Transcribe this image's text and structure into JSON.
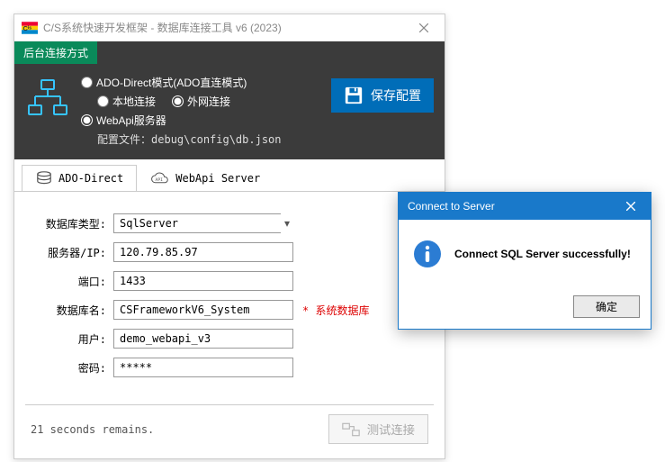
{
  "window": {
    "title": "C/S系统快速开发框架 - 数据库连接工具 v6 (2023)"
  },
  "panel": {
    "header": "后台连接方式",
    "opt_ado": "ADO-Direct模式(ADO直连模式)",
    "opt_local": "本地连接",
    "opt_external": "外网连接",
    "opt_webapi": "WebApi服务器",
    "cfg_label": "配置文件：",
    "cfg_path": "debug\\config\\db.json",
    "save_label": "保存配置"
  },
  "tabs": {
    "ado": "ADO-Direct",
    "webapi": "WebApi Server"
  },
  "form": {
    "db_type_label": "数据库类型:",
    "db_type_value": "SqlServer",
    "server_label": "服务器/IP:",
    "server_value": "120.79.85.97",
    "port_label": "端口:",
    "port_value": "1433",
    "dbname_label": "数据库名:",
    "dbname_value": "CSFrameworkV6_System",
    "dbname_note": "* 系统数据库",
    "user_label": "用户:",
    "user_value": "demo_webapi_v3",
    "pwd_label": "密码:",
    "pwd_value": "*****"
  },
  "footer": {
    "remains": "21 seconds remains.",
    "test_label": "测试连接"
  },
  "dialog": {
    "title": "Connect to Server",
    "message": "Connect SQL Server successfully!",
    "ok": "确定"
  }
}
